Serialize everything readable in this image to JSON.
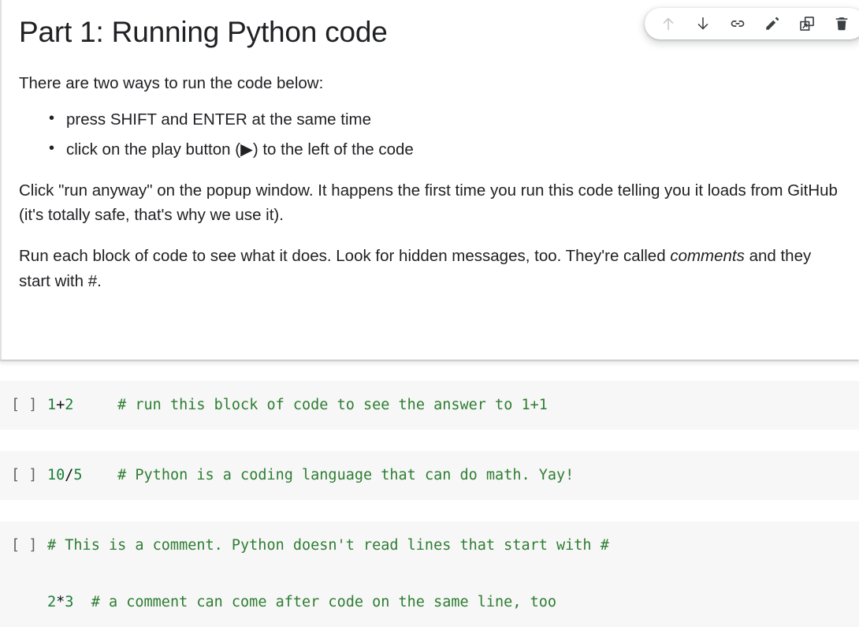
{
  "markdown_cell": {
    "title": "Part 1: Running Python code",
    "intro": "There are two ways to run the code below:",
    "bullets": [
      "press SHIFT and ENTER at the same time",
      "click on the play button (▶) to the left of the code"
    ],
    "paragraph_popup": "Click \"run anyway\" on the popup window. It happens the first time you run this code telling you it loads from GitHub (it's totally safe, that's why we use it).",
    "paragraph_comments_pre": "Run each block of code to see what it does. Look for hidden messages, too. They're called ",
    "paragraph_comments_em": "comments",
    "paragraph_comments_post": " and they start with #."
  },
  "toolbar": {
    "buttons": [
      {
        "name": "move-cell-up",
        "icon": "arrow-up-icon",
        "state": "disabled"
      },
      {
        "name": "move-cell-down",
        "icon": "arrow-down-icon",
        "state": "enabled"
      },
      {
        "name": "copy-link-to-cell",
        "icon": "link-icon",
        "state": "enabled"
      },
      {
        "name": "edit-cell",
        "icon": "pencil-icon",
        "state": "enabled"
      },
      {
        "name": "mirror-cell-in-tab",
        "icon": "open-in-new-tab-icon",
        "state": "enabled"
      },
      {
        "name": "delete-cell",
        "icon": "trash-icon",
        "state": "enabled"
      }
    ]
  },
  "code_cells": [
    {
      "run_indicator": "[ ]",
      "lines": [
        {
          "tokens": [
            {
              "text": "1",
              "type": "num"
            },
            {
              "text": "+",
              "type": "op"
            },
            {
              "text": "2",
              "type": "num"
            },
            {
              "text": "     ",
              "type": "op"
            },
            {
              "text": "# run this block of code to see the answer to 1+1",
              "type": "comment"
            }
          ]
        }
      ]
    },
    {
      "run_indicator": "[ ]",
      "lines": [
        {
          "tokens": [
            {
              "text": "10",
              "type": "num"
            },
            {
              "text": "/",
              "type": "op"
            },
            {
              "text": "5",
              "type": "num"
            },
            {
              "text": "    ",
              "type": "op"
            },
            {
              "text": "# Python is a coding language that can do math. Yay!",
              "type": "comment"
            }
          ]
        }
      ]
    },
    {
      "run_indicator": "[ ]",
      "lines": [
        {
          "tokens": [
            {
              "text": "# This is a comment. Python doesn't read lines that start with #",
              "type": "comment"
            }
          ]
        },
        {
          "tokens": [
            {
              "text": "",
              "type": "op"
            }
          ]
        },
        {
          "tokens": [
            {
              "text": "2",
              "type": "num"
            },
            {
              "text": "*",
              "type": "op"
            },
            {
              "text": "3",
              "type": "num"
            },
            {
              "text": "  ",
              "type": "op"
            },
            {
              "text": "# a comment can come after code on the same line, too",
              "type": "comment"
            }
          ]
        }
      ]
    }
  ],
  "colors": {
    "code_cell_background": "#f7f7f7",
    "comment_green": "#2e7d32",
    "number_green": "#1a7f37",
    "gutter_gray": "#5f6368",
    "text_primary": "#202124"
  }
}
